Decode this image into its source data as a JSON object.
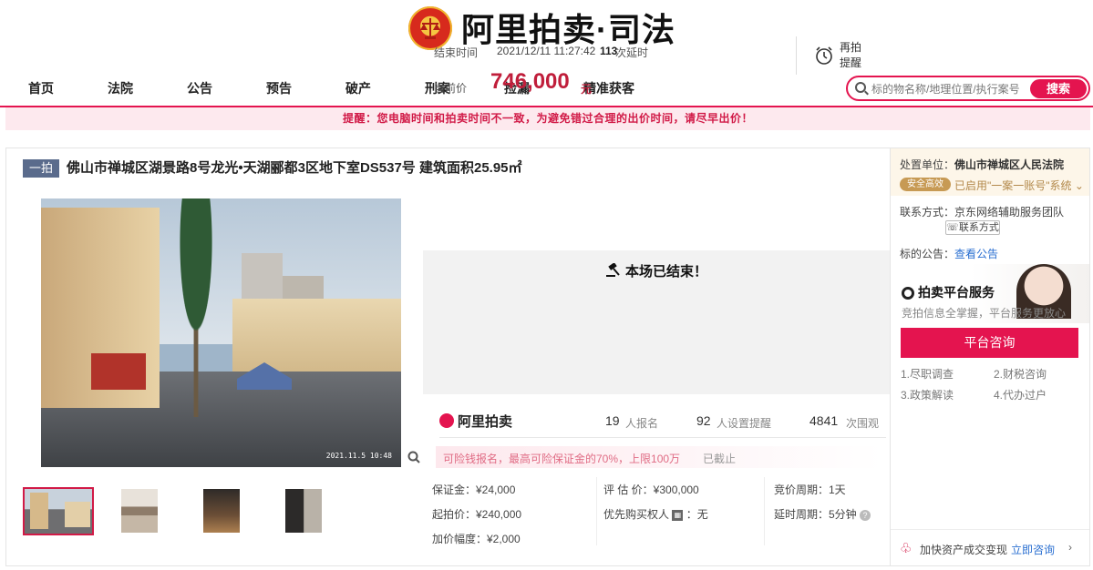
{
  "header": {
    "logo_text": "阿里拍卖·司法"
  },
  "nav": {
    "items": [
      "首页",
      "法院",
      "公告",
      "预告",
      "破产",
      "刑案",
      "捡漏",
      "精准获客"
    ],
    "search_placeholder": "标的物名称/地理位置/执行案号",
    "search_button": "搜索"
  },
  "notice": "提醒：您电脑时间和拍卖时间不一致，为避免错过合理的出价时间，请尽早出价！",
  "item": {
    "badge": "一拍",
    "title": "佛山市禅城区湖景路8号龙光•天湖郦都3区地下室DS537号 建筑面积25.95㎡",
    "photo_timestamp": "2021.11.5 10:48"
  },
  "auction": {
    "end_label": "结束时间",
    "end_time": "2021/12/11 11:27:42",
    "delay_count": "113",
    "delay_label": "次延时",
    "remind_label": "再拍提醒",
    "price_label": "当前价",
    "current_price": "746,000",
    "price_unit": "元",
    "ended_text": "本场已结束！"
  },
  "stats": {
    "brand": "阿里拍卖",
    "signups": "19",
    "signups_label": "人报名",
    "reminders": "92",
    "reminders_label": "人设置提醒",
    "views": "4841",
    "views_label": "次围观"
  },
  "deposit": {
    "text": "可险钱报名，最高可险保证金的70%，上限100万",
    "status": "已截止"
  },
  "details": {
    "deposit": "保证金：¥24,000",
    "appraisal": "评 估 价：¥300,000",
    "cycle": "竞价周期：1天",
    "start_price": "起拍价：¥240,000",
    "priority_label": "优先购买权人",
    "priority_value": "：无",
    "extension": "延时周期：5分钟",
    "increment": "加价幅度：¥2,000"
  },
  "side": {
    "unit_label": "处置单位：",
    "unit_value": "佛山市禅城区人民法院",
    "safe_badge": "安全高效",
    "one_case": "已启用\"一案一账号\"系统",
    "contact_label": "联系方式：",
    "contact_value": "京东网络辅助服务团队",
    "contact_button": "联系方式",
    "notice_label": "标的公告：",
    "notice_link": "查看公告",
    "service_title": "拍卖平台服务",
    "service_sub": "竞拍信息全掌握，平台服务更放心",
    "consult_button": "平台咨询",
    "menu": [
      "1.尽职调查",
      "2.财税咨询",
      "3.政策解读",
      "4.代办过户"
    ],
    "bottom_text": "加快资产成交变现",
    "bottom_link": "立即咨询"
  }
}
